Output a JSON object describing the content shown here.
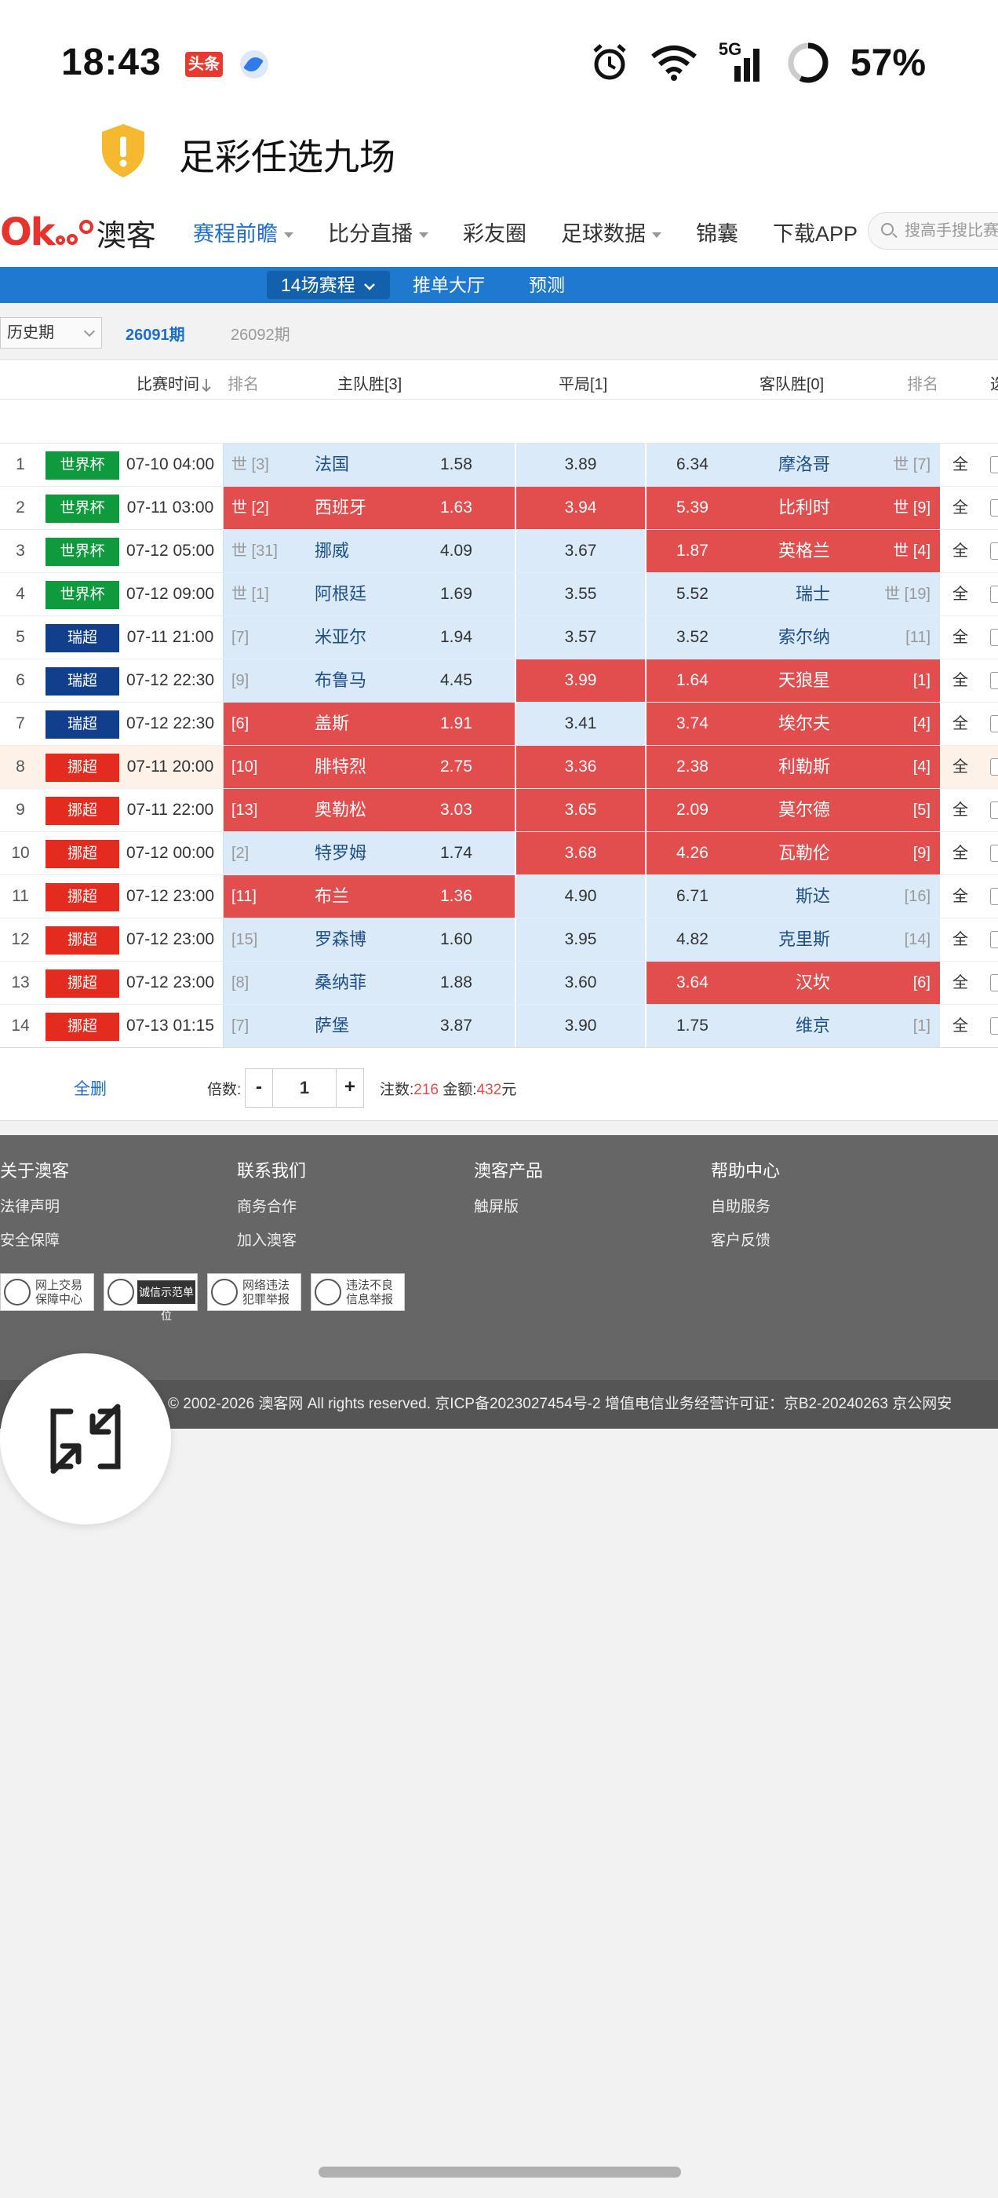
{
  "status_bar": {
    "time": "18:43",
    "badge": "头条",
    "network": "5G",
    "battery": "57%"
  },
  "app": {
    "title": "足彩任选九场"
  },
  "nav": {
    "logo_text": "澳客",
    "items": [
      {
        "label": "赛程前瞻",
        "dropdown": true,
        "active": true
      },
      {
        "label": "比分直播",
        "dropdown": true,
        "active": false
      },
      {
        "label": "彩友圈",
        "dropdown": false,
        "active": false
      },
      {
        "label": "足球数据",
        "dropdown": true,
        "active": false
      },
      {
        "label": "锦囊",
        "dropdown": false,
        "active": false
      },
      {
        "label": "下载APP",
        "dropdown": false,
        "active": false
      }
    ],
    "search_placeholder": "搜高手搜比赛"
  },
  "subnav": {
    "items": [
      "14场赛程",
      "推单大厅",
      "预测"
    ]
  },
  "period": {
    "select_label": "历史期",
    "current": "26091期",
    "other": "26092期"
  },
  "table": {
    "headers": {
      "time": "比赛时间",
      "home_rank": "排名",
      "home": "主队胜[3]",
      "draw": "平局[1]",
      "away": "客队胜[0]",
      "away_rank": "排名",
      "select": "选"
    },
    "all_label": "全",
    "rows": [
      {
        "num": "1",
        "league": "世界杯",
        "time": "07-10 04:00",
        "home_rank": "世 [3]",
        "home": "法国",
        "home_odd": "1.58",
        "draw": "3.89",
        "away_odd": "6.34",
        "away": "摩洛哥",
        "away_rank": "世 [7]",
        "sel_home": false,
        "sel_draw": false,
        "sel_away": false
      },
      {
        "num": "2",
        "league": "世界杯",
        "time": "07-11 03:00",
        "home_rank": "世 [2]",
        "home": "西班牙",
        "home_odd": "1.63",
        "draw": "3.94",
        "away_odd": "5.39",
        "away": "比利时",
        "away_rank": "世 [9]",
        "sel_home": true,
        "sel_draw": true,
        "sel_away": true
      },
      {
        "num": "3",
        "league": "世界杯",
        "time": "07-12 05:00",
        "home_rank": "世 [31]",
        "home": "挪威",
        "home_odd": "4.09",
        "draw": "3.67",
        "away_odd": "1.87",
        "away": "英格兰",
        "away_rank": "世 [4]",
        "sel_home": false,
        "sel_draw": false,
        "sel_away": true
      },
      {
        "num": "4",
        "league": "世界杯",
        "time": "07-12 09:00",
        "home_rank": "世 [1]",
        "home": "阿根廷",
        "home_odd": "1.69",
        "draw": "3.55",
        "away_odd": "5.52",
        "away": "瑞士",
        "away_rank": "世 [19]",
        "sel_home": false,
        "sel_draw": false,
        "sel_away": false
      },
      {
        "num": "5",
        "league": "瑞超",
        "time": "07-11 21:00",
        "home_rank": "[7]",
        "home": "米亚尔",
        "home_odd": "1.94",
        "draw": "3.57",
        "away_odd": "3.52",
        "away": "索尔纳",
        "away_rank": "[11]",
        "sel_home": false,
        "sel_draw": false,
        "sel_away": false
      },
      {
        "num": "6",
        "league": "瑞超",
        "time": "07-12 22:30",
        "home_rank": "[9]",
        "home": "布鲁马",
        "home_odd": "4.45",
        "draw": "3.99",
        "away_odd": "1.64",
        "away": "天狼星",
        "away_rank": "[1]",
        "sel_home": false,
        "sel_draw": true,
        "sel_away": true
      },
      {
        "num": "7",
        "league": "瑞超",
        "time": "07-12 22:30",
        "home_rank": "[6]",
        "home": "盖斯",
        "home_odd": "1.91",
        "draw": "3.41",
        "away_odd": "3.74",
        "away": "埃尔夫",
        "away_rank": "[4]",
        "sel_home": true,
        "sel_draw": false,
        "sel_away": true
      },
      {
        "num": "8",
        "league": "挪超",
        "time": "07-11 20:00",
        "home_rank": "[10]",
        "home": "腓特烈",
        "home_odd": "2.75",
        "draw": "3.36",
        "away_odd": "2.38",
        "away": "利勒斯",
        "away_rank": "[4]",
        "sel_home": true,
        "sel_draw": true,
        "sel_away": true
      },
      {
        "num": "9",
        "league": "挪超",
        "time": "07-11 22:00",
        "home_rank": "[13]",
        "home": "奥勒松",
        "home_odd": "3.03",
        "draw": "3.65",
        "away_odd": "2.09",
        "away": "莫尔德",
        "away_rank": "[5]",
        "sel_home": true,
        "sel_draw": true,
        "sel_away": true
      },
      {
        "num": "10",
        "league": "挪超",
        "time": "07-12 00:00",
        "home_rank": "[2]",
        "home": "特罗姆",
        "home_odd": "1.74",
        "draw": "3.68",
        "away_odd": "4.26",
        "away": "瓦勒伦",
        "away_rank": "[9]",
        "sel_home": false,
        "sel_draw": true,
        "sel_away": true
      },
      {
        "num": "11",
        "league": "挪超",
        "time": "07-12 23:00",
        "home_rank": "[11]",
        "home": "布兰",
        "home_odd": "1.36",
        "draw": "4.90",
        "away_odd": "6.71",
        "away": "斯达",
        "away_rank": "[16]",
        "sel_home": true,
        "sel_draw": false,
        "sel_away": false
      },
      {
        "num": "12",
        "league": "挪超",
        "time": "07-12 23:00",
        "home_rank": "[15]",
        "home": "罗森博",
        "home_odd": "1.60",
        "draw": "3.95",
        "away_odd": "4.82",
        "away": "克里斯",
        "away_rank": "[14]",
        "sel_home": false,
        "sel_draw": false,
        "sel_away": false
      },
      {
        "num": "13",
        "league": "挪超",
        "time": "07-12 23:00",
        "home_rank": "[8]",
        "home": "桑纳菲",
        "home_odd": "1.88",
        "draw": "3.60",
        "away_odd": "3.64",
        "away": "汉坎",
        "away_rank": "[6]",
        "sel_home": false,
        "sel_draw": false,
        "sel_away": true
      },
      {
        "num": "14",
        "league": "挪超",
        "time": "07-13 01:15",
        "home_rank": "[7]",
        "home": "萨堡",
        "home_odd": "3.87",
        "draw": "3.90",
        "away_odd": "1.75",
        "away": "维京",
        "away_rank": "[1]",
        "sel_home": false,
        "sel_draw": false,
        "sel_away": false
      }
    ]
  },
  "action_bar": {
    "clear_label": "全删",
    "multiplier_label": "倍数:",
    "minus": "-",
    "multiplier_value": "1",
    "plus": "+",
    "bets_label": "注数:",
    "bets_value": "216",
    "amount_label": "金额:",
    "amount_value": "432",
    "amount_unit": "元"
  },
  "footer": {
    "columns": [
      {
        "title": "关于澳客",
        "links": [
          "法律声明",
          "安全保障"
        ]
      },
      {
        "title": "联系我们",
        "links": [
          "商务合作",
          "加入澳客"
        ]
      },
      {
        "title": "澳客产品",
        "links": [
          "触屏版"
        ]
      },
      {
        "title": "帮助中心",
        "links": [
          "自助服务",
          "客户反馈"
        ]
      }
    ],
    "badges": [
      "网上交易保障中心",
      "诚信示范单位",
      "网络违法犯罪举报",
      "违法不良信息举报"
    ],
    "copyright": "© 2002-2026 澳客网  All rights reserved.   京ICP备2023027454号-2  增值电信业务经营许可证：京B2-20240263  京公网安"
  },
  "colors": {
    "accent_blue": "#1f79cf",
    "selected_red": "#e24e4e",
    "cell_blue": "#dbeaf8",
    "league_worldcup": "#0f9b3d",
    "league_sweden": "#123f8c",
    "league_norway": "#e42b20"
  }
}
